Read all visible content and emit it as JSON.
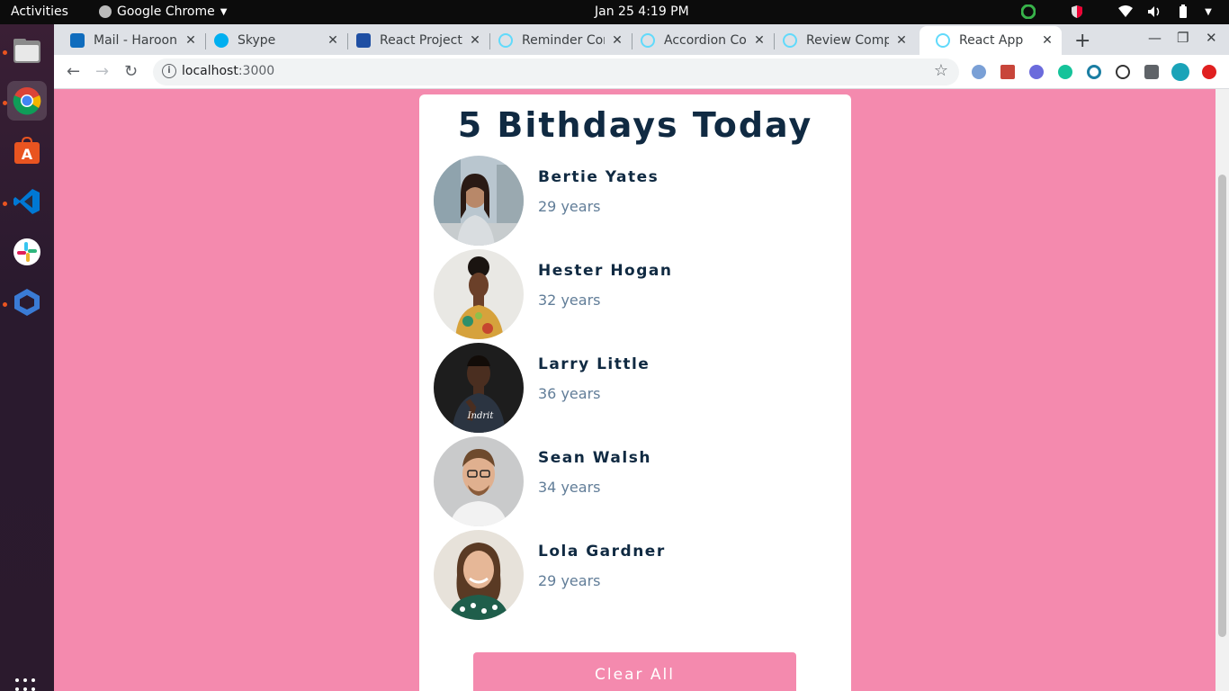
{
  "system": {
    "activities": "Activities",
    "app_name": "Google Chrome",
    "clock": "Jan 25   4:19 PM"
  },
  "browser": {
    "tabs": [
      {
        "label": "Mail - Haroon",
        "favicon_color": "#0f6cbd"
      },
      {
        "label": "Skype",
        "favicon_color": "#00aff0"
      },
      {
        "label": "React Projects",
        "favicon_color": "#1f4fa3"
      },
      {
        "label": "Reminder Com",
        "favicon_color": "#61dafb"
      },
      {
        "label": "Accordion Co",
        "favicon_color": "#61dafb"
      },
      {
        "label": "Review Compo",
        "favicon_color": "#61dafb"
      },
      {
        "label": "React App",
        "favicon_color": "#61dafb"
      }
    ],
    "url_host": "localhost",
    "url_port": ":3000"
  },
  "page": {
    "title": "5 Bithdays Today",
    "people": [
      {
        "name": "Bertie Yates",
        "age": "29 years"
      },
      {
        "name": "Hester Hogan",
        "age": "32 years"
      },
      {
        "name": "Larry Little",
        "age": "36 years"
      },
      {
        "name": "Sean Walsh",
        "age": "34 years"
      },
      {
        "name": "Lola Gardner",
        "age": "29 years"
      }
    ],
    "clear_button": "Clear All"
  },
  "colors": {
    "background": "#f48aae",
    "heading": "#102a42",
    "subtext": "#617d98"
  }
}
